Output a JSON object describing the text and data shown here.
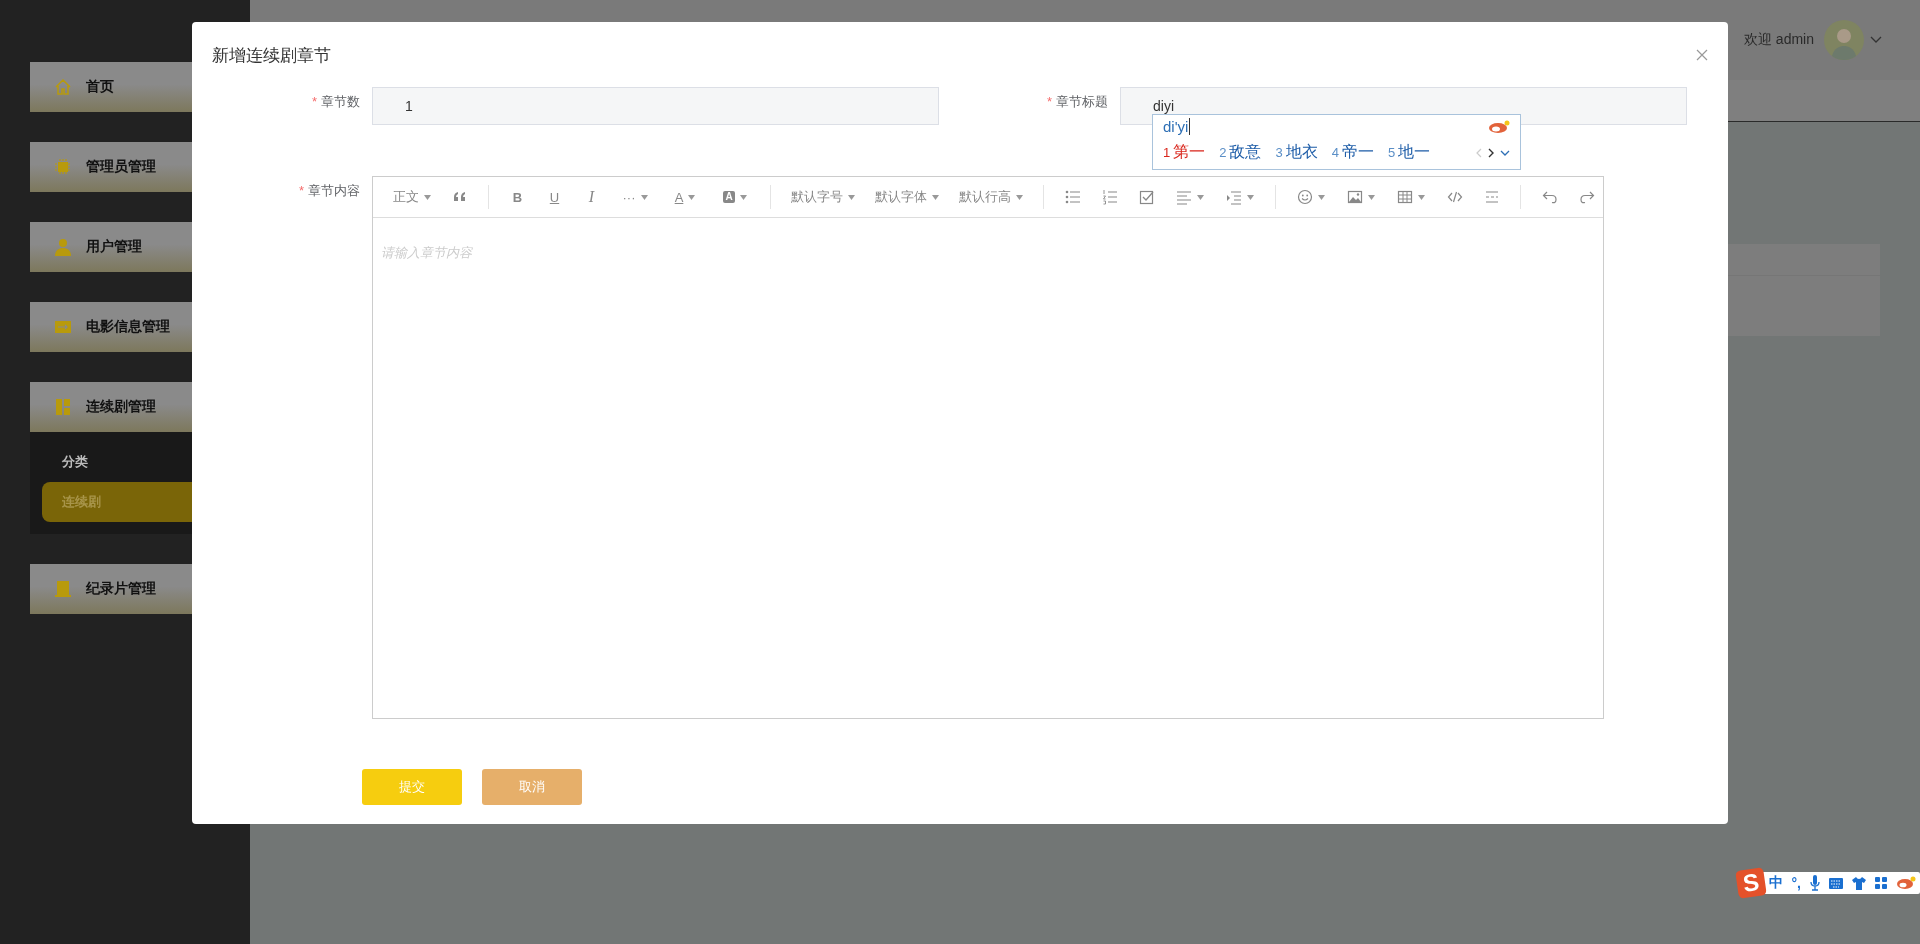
{
  "sidebar": {
    "items": [
      {
        "label": "首页",
        "selected": false
      },
      {
        "label": "管理员管理",
        "selected": false
      },
      {
        "label": "用户管理",
        "selected": false
      },
      {
        "label": "电影信息管理",
        "selected": false
      },
      {
        "label": "连续剧管理",
        "selected": false,
        "expanded": true,
        "children": [
          {
            "label": "分类",
            "selected": false
          },
          {
            "label": "连续剧",
            "selected": true
          }
        ]
      },
      {
        "label": "纪录片管理",
        "selected": false
      }
    ]
  },
  "header": {
    "greeting": "欢迎 admin"
  },
  "dialog": {
    "title": "新增连续剧章节",
    "fields": [
      {
        "marker": "*",
        "label": "章节数",
        "value": "1"
      },
      {
        "marker": "*",
        "label": "章节标题",
        "value": "diyi"
      }
    ],
    "editor": {
      "marker": "*",
      "label": "章节内容",
      "placeholder": "请输入章节内容",
      "toolbar": [
        {
          "items": [
            {
              "kind": "text",
              "label": "正文",
              "dropdown": true
            },
            {
              "kind": "quote",
              "dropdown": false
            }
          ]
        },
        {
          "items": [
            {
              "kind": "bold",
              "label": "B",
              "dropdown": false
            },
            {
              "kind": "underline",
              "label": "U",
              "dropdown": false
            },
            {
              "kind": "italic",
              "label": "I",
              "dropdown": false
            },
            {
              "kind": "more",
              "label": "···",
              "dropdown": true
            },
            {
              "kind": "color",
              "label": "A",
              "dropdown": true
            },
            {
              "kind": "highlight",
              "label": "A",
              "dropdown": true
            }
          ]
        },
        {
          "items": [
            {
              "kind": "text",
              "label": "默认字号",
              "dropdown": true
            },
            {
              "kind": "text",
              "label": "默认字体",
              "dropdown": true
            },
            {
              "kind": "text",
              "label": "默认行高",
              "dropdown": true
            }
          ]
        },
        {
          "items": [
            {
              "kind": "bullets",
              "dropdown": false
            },
            {
              "kind": "numbers",
              "dropdown": false
            },
            {
              "kind": "todo",
              "dropdown": false
            },
            {
              "kind": "align",
              "dropdown": true
            },
            {
              "kind": "indent",
              "dropdown": true
            }
          ]
        },
        {
          "items": [
            {
              "kind": "emoji",
              "dropdown": true
            },
            {
              "kind": "image",
              "dropdown": true
            },
            {
              "kind": "table",
              "dropdown": true
            },
            {
              "kind": "code",
              "dropdown": false
            },
            {
              "kind": "divider",
              "dropdown": false
            }
          ]
        },
        {
          "items": [
            {
              "kind": "undo",
              "dropdown": false
            },
            {
              "kind": "redo",
              "dropdown": false
            }
          ]
        }
      ]
    },
    "buttons": [
      {
        "label": "提交",
        "kind": "primary"
      },
      {
        "label": "取消",
        "kind": "cancel"
      }
    ]
  },
  "ime_popup": {
    "composition": "di'yi",
    "candidates": [
      {
        "number": "1",
        "text": "第一",
        "selected": true
      },
      {
        "number": "2",
        "text": "敌意",
        "selected": false
      },
      {
        "number": "3",
        "text": "地衣",
        "selected": false
      },
      {
        "number": "4",
        "text": "帝一",
        "selected": false
      },
      {
        "number": "5",
        "text": "地一",
        "selected": false
      }
    ]
  },
  "ime_bar": {
    "logo": "S",
    "mode": "中",
    "punctuation": "°,"
  }
}
